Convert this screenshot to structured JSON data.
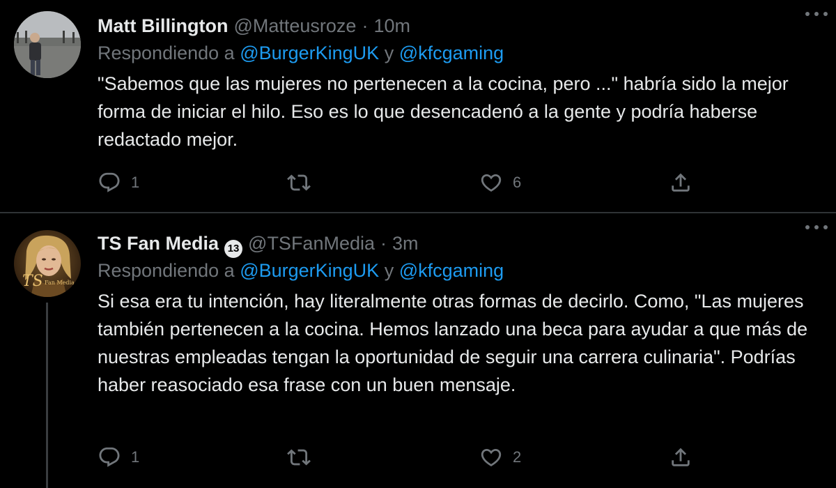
{
  "colors": {
    "background": "#000000",
    "text": "#e7e9ea",
    "muted": "#71767b",
    "link": "#1d9bf0",
    "divider": "#2f3336"
  },
  "tweets": [
    {
      "name": "Matt Billington",
      "handle": "@Matteusroze",
      "separator": "·",
      "time": "10m",
      "replying_prefix": "Respondiendo a",
      "mention_1": "@BurgerKingUK",
      "conjunction": "y",
      "mention_2": "@kfcgaming",
      "text": "\"Sabemos que las mujeres no pertenecen a la cocina, pero ...\" habría sido la mejor forma de iniciar el hilo. Eso es lo que desencadenó a la gente y podría haberse redactado mejor.",
      "reply_count": "1",
      "retweet_count": "",
      "like_count": "6",
      "icons": [
        "reply-icon",
        "retweet-icon",
        "like-icon",
        "share-icon",
        "more-icon"
      ]
    },
    {
      "name": "TS Fan Media",
      "badge": "13",
      "handle": "@TSFanMedia",
      "separator": "·",
      "time": "3m",
      "replying_prefix": "Respondiendo a",
      "mention_1": "@BurgerKingUK",
      "conjunction": "y",
      "mention_2": "@kfcgaming",
      "text": "Si esa era tu intención, hay literalmente otras formas de decirlo. Como, \"Las mujeres también pertenecen a la cocina. Hemos lanzado una beca para ayudar a que más de nuestras empleadas tengan la oportunidad de seguir una carrera culinaria\". Podrías haber reasociado esa frase con un buen mensaje.",
      "avatar_text": "Fan Media",
      "reply_count": "1",
      "retweet_count": "",
      "like_count": "2",
      "icons": [
        "reply-icon",
        "retweet-icon",
        "like-icon",
        "share-icon",
        "more-icon"
      ]
    }
  ]
}
